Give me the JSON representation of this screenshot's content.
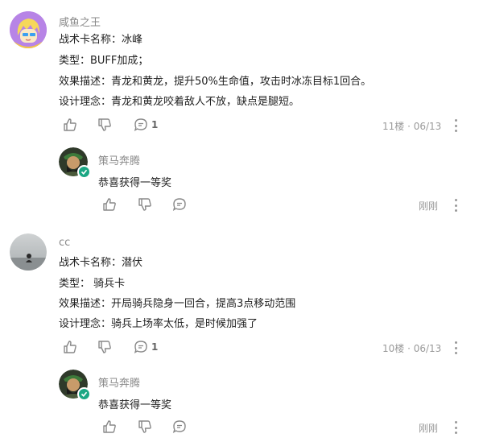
{
  "comments": [
    {
      "author": "咸鱼之王",
      "lines": [
        "战术卡名称：冰峰",
        "类型：BUFF加成；",
        "效果描述：青龙和黄龙，提升50%生命值，攻击时冰冻目标1回合。",
        "设计理念：青龙和黄龙咬着敌人不放，缺点是腿短。"
      ],
      "reply_count": "1",
      "floor": "11楼 · 06/13",
      "reply": {
        "author": "策马奔腾",
        "text": "恭喜获得一等奖",
        "time": "刚刚"
      }
    },
    {
      "author": "cc",
      "lines": [
        "战术卡名称：潜伏",
        "类型：  骑兵卡",
        "效果描述：开局骑兵隐身一回合，提高3点移动范围",
        "设计理念：骑兵上场率太低，是时候加强了"
      ],
      "reply_count": "1",
      "floor": "10楼 · 06/13",
      "reply": {
        "author": "策马奔腾",
        "text": "恭喜获得一等奖",
        "time": "刚刚"
      }
    }
  ],
  "icons": {
    "like": "thumbs-up-icon",
    "dislike": "thumbs-down-icon",
    "comment": "comment-bubble-icon",
    "more": "more-vertical-icon",
    "verified": "verified-check-icon"
  },
  "colors": {
    "verified_badge": "#1ba784",
    "muted_text": "#8a8a8a"
  }
}
